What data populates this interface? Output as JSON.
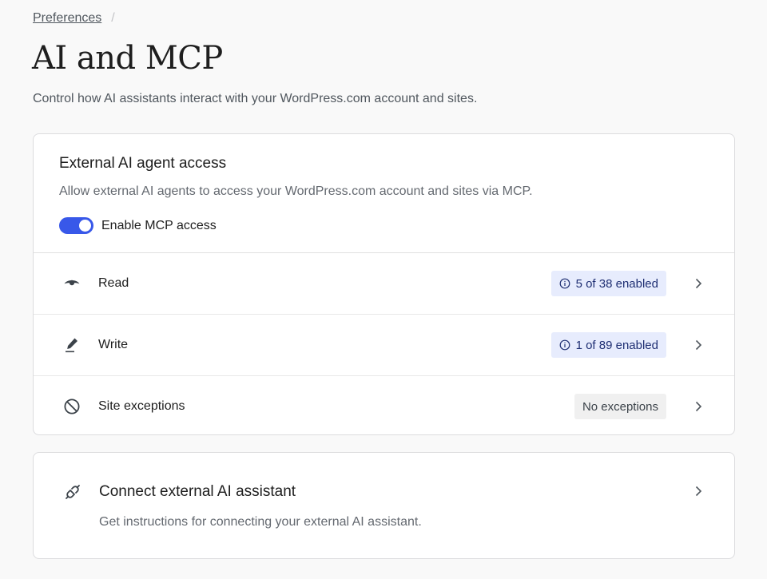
{
  "breadcrumb": {
    "parent": "Preferences",
    "separator": "/"
  },
  "page": {
    "title": "AI and MCP",
    "description": "Control how AI assistants interact with your WordPress.com account and sites."
  },
  "external_access": {
    "title": "External AI agent access",
    "description": "Allow external AI agents to access your WordPress.com account and sites via MCP.",
    "toggle_label": "Enable MCP access",
    "toggle_on": true,
    "rows": [
      {
        "label": "Read",
        "icon": "eye-icon",
        "badge": "5 of 38 enabled",
        "badge_type": "info"
      },
      {
        "label": "Write",
        "icon": "pencil-icon",
        "badge": "1 of 89 enabled",
        "badge_type": "info"
      },
      {
        "label": "Site exceptions",
        "icon": "block-icon",
        "badge": "No exceptions",
        "badge_type": "neutral"
      }
    ]
  },
  "connect": {
    "title": "Connect external AI assistant",
    "description": "Get instructions for connecting your external AI assistant.",
    "icon": "plug-icon"
  },
  "colors": {
    "accent": "#3858e9",
    "info_badge_bg": "#e7ecfd",
    "neutral_badge_bg": "#f0f0f0"
  }
}
